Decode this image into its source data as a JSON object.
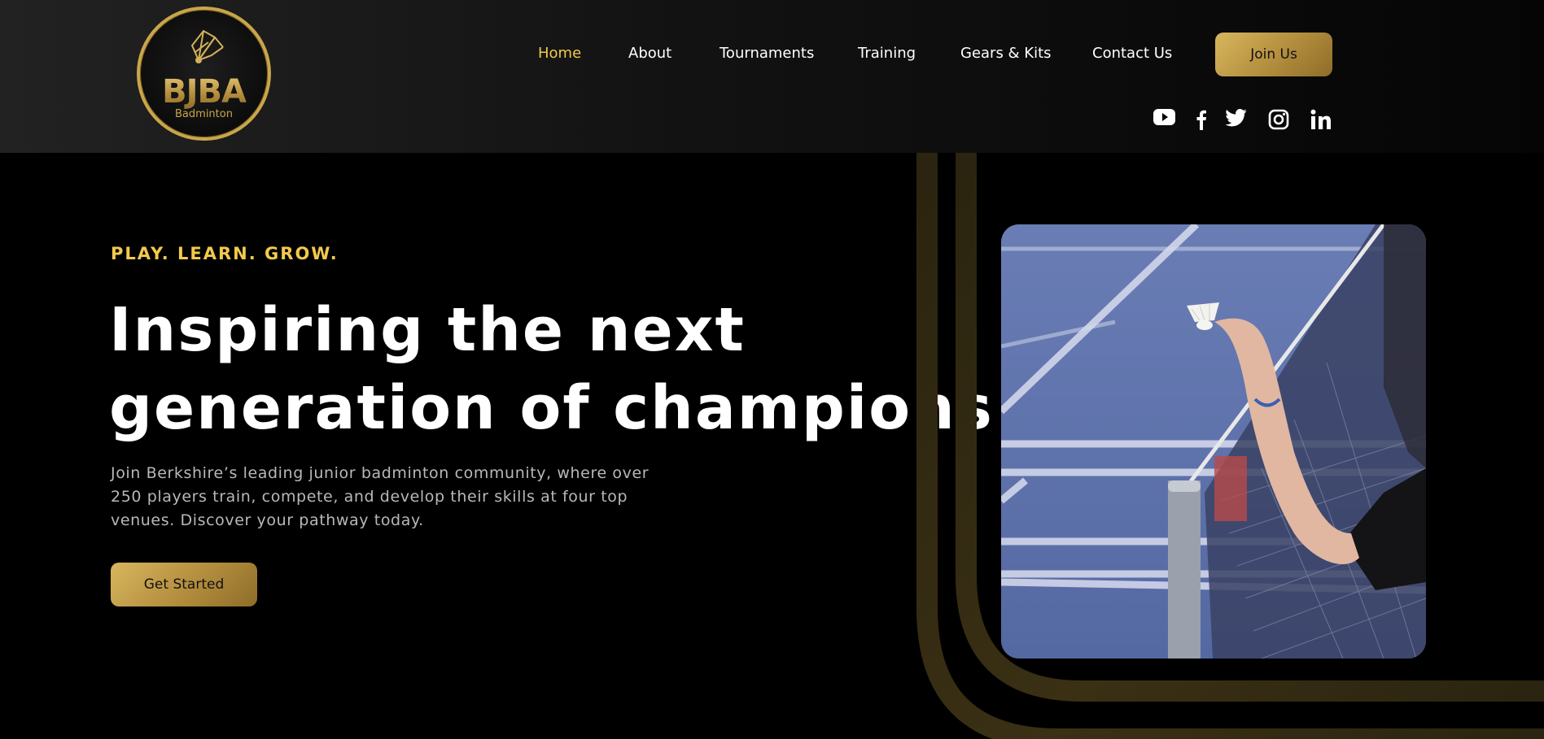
{
  "brand": {
    "logo_text": "BJBA",
    "logo_subtext": "Badminton"
  },
  "nav": {
    "items": [
      {
        "label": "Home",
        "active": true
      },
      {
        "label": "About",
        "active": false
      },
      {
        "label": "Tournaments",
        "active": false
      },
      {
        "label": "Training",
        "active": false
      },
      {
        "label": "Gears & Kits",
        "active": false
      },
      {
        "label": "Contact Us",
        "active": false
      }
    ],
    "cta_label": "Join Us"
  },
  "social": [
    "youtube-icon",
    "facebook-icon",
    "twitter-icon",
    "instagram-icon",
    "linkedin-icon"
  ],
  "hero": {
    "tagline": "PLAY. LEARN. GROW.",
    "headline_line1": "Inspiring the next",
    "headline_line2": "generation of champions",
    "intro": "Join Berkshire’s leading junior badminton community, where over 250 players train, compete, and develop their skills at four top venues. Discover your pathway today.",
    "cta_label": "Get Started"
  },
  "colors": {
    "accent_gold": "#f2c94c",
    "button_gold": "#c9a64a",
    "background": "#000000",
    "muted_text": "#b8b8b8"
  }
}
